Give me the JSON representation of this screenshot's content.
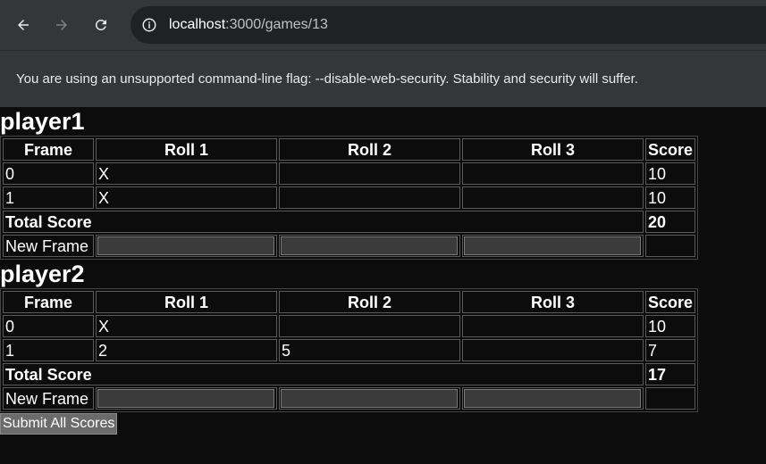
{
  "browser": {
    "url_host": "localhost",
    "url_path": ":3000/games/13",
    "infobar_message": "You are using an unsupported command-line flag: --disable-web-security. Stability and security will suffer."
  },
  "table_headers": {
    "frame": "Frame",
    "roll1": "Roll 1",
    "roll2": "Roll 2",
    "roll3": "Roll 3",
    "score": "Score"
  },
  "players": [
    {
      "name": "player1",
      "frames": [
        {
          "frame": "0",
          "roll1": "X",
          "roll2": "",
          "roll3": "",
          "score": "10"
        },
        {
          "frame": "1",
          "roll1": "X",
          "roll2": "",
          "roll3": "",
          "score": "10"
        }
      ],
      "total_label": "Total Score",
      "total": "20",
      "new_frame_label": "New Frame"
    },
    {
      "name": "player2",
      "frames": [
        {
          "frame": "0",
          "roll1": "X",
          "roll2": "",
          "roll3": "",
          "score": "10"
        },
        {
          "frame": "1",
          "roll1": "2",
          "roll2": "5",
          "roll3": "",
          "score": "7"
        }
      ],
      "total_label": "Total Score",
      "total": "17",
      "new_frame_label": "New Frame"
    }
  ],
  "submit_label": "Submit All Scores"
}
